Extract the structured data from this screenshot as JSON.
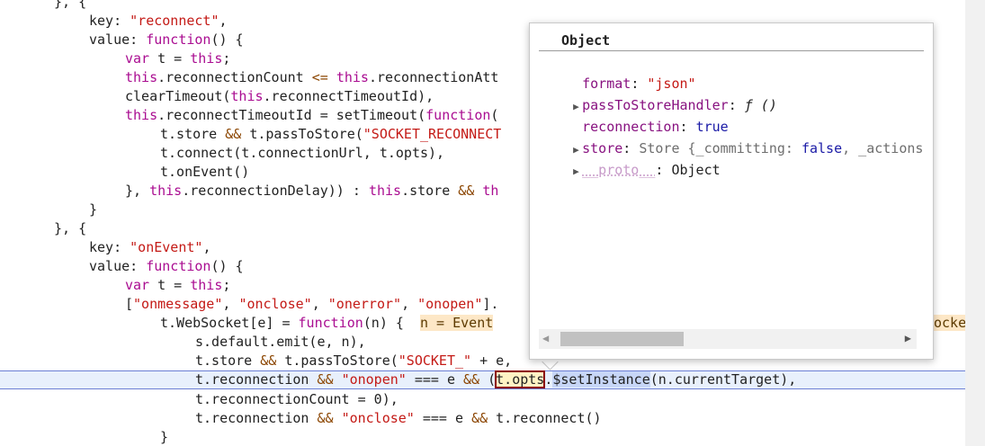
{
  "code": {
    "l1": "}, {",
    "l2_key": "key: ",
    "l2_str": "\"reconnect\"",
    "l2_end": ",",
    "l3_a": "value: ",
    "l3_kw": "function",
    "l3_b": "() {",
    "l4_kw1": "var",
    "l4_a": " t = ",
    "l4_kw2": "this",
    "l4_b": ";",
    "l5_kw": "this",
    "l5_a": ".reconnectionCount ",
    "l5_op": "<=",
    "l5_sp": " ",
    "l5_kw2": "this",
    "l5_b": ".reconnectionAtt",
    "l6_a": "clearTimeout(",
    "l6_kw": "this",
    "l6_b": ".reconnectTimeoutId),",
    "l7_kw": "this",
    "l7_a": ".reconnectTimeoutId = setTimeout(",
    "l7_kw2": "function",
    "l7_b": "(",
    "l8_a": "t.store ",
    "l8_op": "&&",
    "l8_b": " t.passToStore(",
    "l8_str": "\"SOCKET_RECONNECT",
    "l9": "t.connect(t.connectionUrl, t.opts),",
    "l10": "t.onEvent()",
    "l11_a": "}, ",
    "l11_kw": "this",
    "l11_b": ".reconnectionDelay)) : ",
    "l11_kw2": "this",
    "l11_c": ".store ",
    "l11_op": "&&",
    "l11_d": " ",
    "l11_kw3": "th",
    "l12": "}",
    "l13": "}, {",
    "l14_key": "key: ",
    "l14_str": "\"onEvent\"",
    "l14_end": ",",
    "l15_a": "value: ",
    "l15_kw": "function",
    "l15_b": "() {",
    "l16_kw1": "var",
    "l16_a": " t = ",
    "l16_kw2": "this",
    "l16_b": ";",
    "l17_a": "[",
    "l17_s1": "\"onmessage\"",
    "l17_c1": ", ",
    "l17_s2": "\"onclose\"",
    "l17_c2": ", ",
    "l17_s3": "\"onerror\"",
    "l17_c3": ", ",
    "l17_s4": "\"onopen\"",
    "l17_b": "].",
    "l18_a": "t.WebSocket[e] = ",
    "l18_kw": "function",
    "l18_b": "(n) {  ",
    "l18_inline": "n = Event",
    "l18_right": "ocke",
    "l19": "s.default.emit(e, n),",
    "l20_a": "t.store ",
    "l20_op": "&&",
    "l20_b": " t.passToStore(",
    "l20_str": "\"SOCKET_\"",
    "l20_c": " + e,",
    "l21_a": "t.reconnection ",
    "l21_op1": "&&",
    "l21_sp": " ",
    "l21_str": "\"onopen\"",
    "l21_b": " === e ",
    "l21_op2": "&&",
    "l21_c": " (",
    "l21_hl": "t.opts",
    "l21_dot": ".",
    "l21_sel": "$setInstance",
    "l21_d": "(n.currentTarget),",
    "l22": "t.reconnectionCount = 0),",
    "l23_a": "t.reconnection ",
    "l23_op1": "&&",
    "l23_sp": " ",
    "l23_str": "\"onclose\"",
    "l23_b": " === e ",
    "l23_op2": "&&",
    "l23_c": " t.reconnect()",
    "l24": "}"
  },
  "popover": {
    "title": "Object",
    "rows": [
      {
        "key": "format",
        "sep": ": ",
        "value": "\"json\""
      },
      {
        "key": "passToStoreHandler",
        "sep": ": ",
        "value": "ƒ ()"
      },
      {
        "key": "reconnection",
        "sep": ": ",
        "value": "true"
      },
      {
        "key": "store",
        "sep": ": ",
        "value_a": "Store {_committing: ",
        "value_b": "false",
        "value_c": ", _actions"
      },
      {
        "key": "__proto__",
        "sep": ": ",
        "value": "Object"
      }
    ],
    "expand_glyph": "▶",
    "scroll_left": "◀",
    "scroll_right": "▶"
  },
  "colors": {
    "keyword": "#aa0d91",
    "string": "#c41a16",
    "active_line": "#e8f0fc",
    "highlight_box": "#8b0000"
  }
}
